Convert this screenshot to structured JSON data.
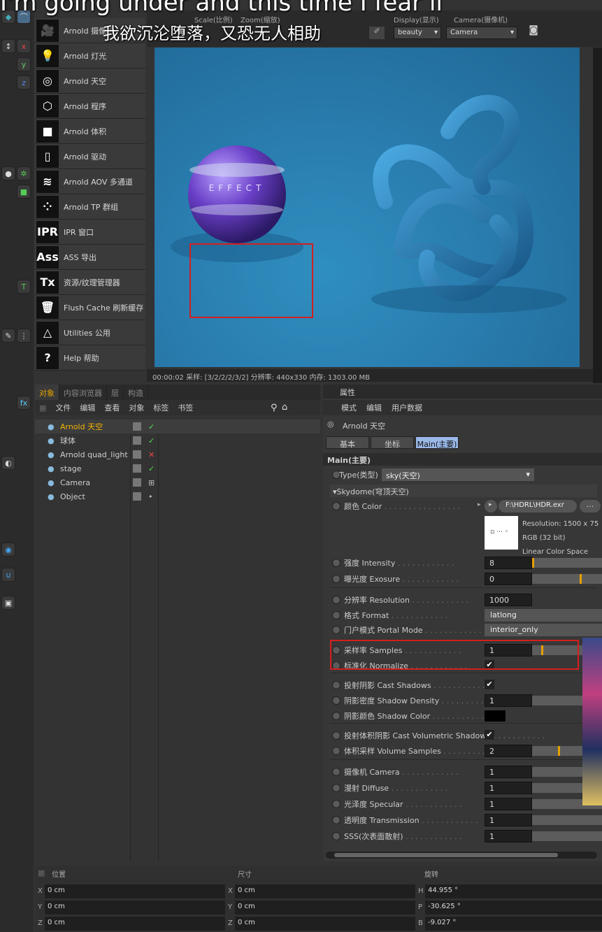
{
  "subtitles": {
    "english": "I'm going under and this time I fear li",
    "chinese": "我欲沉沦堕落，又恐无人相助"
  },
  "viewport_toolbar": {
    "scale_label": "Scale(比例)",
    "zoom_label": "Zoom(缩放)",
    "display_label": "Display(显示)",
    "display_value": "beauty",
    "camera_label": "Camera(摄像机)",
    "camera_value": "Camera"
  },
  "arnold_menu": [
    {
      "icon": "camera-icon",
      "label": "Arnold 摄像机"
    },
    {
      "icon": "lightbulb-icon",
      "label": "Arnold 灯光"
    },
    {
      "icon": "globe-icon",
      "label": "Arnold 天空"
    },
    {
      "icon": "cube-outline-icon",
      "label": "Arnold 程序"
    },
    {
      "icon": "cube-solid-icon",
      "label": "Arnold 体积"
    },
    {
      "icon": "document-icon",
      "label": "Arnold 驱动"
    },
    {
      "icon": "layers-icon",
      "label": "Arnold AOV 多通道"
    },
    {
      "icon": "dots-icon",
      "label": "Arnold TP 群组"
    },
    {
      "icon": "IPR",
      "label": "IPR 窗口"
    },
    {
      "icon": "Ass",
      "label": "ASS 导出"
    },
    {
      "icon": "Tx",
      "label": "资源/纹理管理器"
    },
    {
      "icon": "trash-icon",
      "label": "Flush Cache 刷新缓存"
    },
    {
      "icon": "utilities-icon",
      "label": "Utilities 公用"
    },
    {
      "icon": "?",
      "label": "Help 帮助"
    }
  ],
  "render": {
    "sphere_text": "EFFECT",
    "status": "00:00:02  采样: [3/2/2/2/3/2]  分辨率: 440x330  内存: 1303.00 MB"
  },
  "object_panel": {
    "tabs": [
      "对象",
      "内容浏览器",
      "层",
      "构造"
    ],
    "menu": [
      "文件",
      "编辑",
      "查看",
      "对象",
      "标签",
      "书签"
    ],
    "objects": [
      {
        "name": "Arnold 天空",
        "highlight": true,
        "status": "check"
      },
      {
        "name": "球体",
        "highlight": false,
        "status": "check"
      },
      {
        "name": "Arnold quad_light",
        "highlight": false,
        "status": "x"
      },
      {
        "name": "stage",
        "highlight": false,
        "status": "check"
      },
      {
        "name": "Camera",
        "highlight": false,
        "status": "grid"
      },
      {
        "name": "Object",
        "highlight": false,
        "status": "dot"
      }
    ]
  },
  "attr_panel": {
    "title": "属性",
    "menu": [
      "模式",
      "编辑",
      "用户数据"
    ],
    "object_name": "Arnold 天空",
    "tabs": [
      "基本",
      "坐标",
      "Main(主要)"
    ],
    "section": "Main(主要)",
    "type_label": "Type(类型)",
    "type_value": "sky(天空)",
    "subsection": "▾Skydome(穹顶天空)",
    "color_label": "颜色 Color",
    "file_path": "F:\\HDRL\\HDR.exr",
    "file_more": "...",
    "image_info": [
      "Resolution: 1500 x 75",
      "RGB (32 bit)",
      "Linear Color Space"
    ],
    "params": [
      {
        "label": "强度 Intensity",
        "value": "8",
        "slider": 0.0
      },
      {
        "label": "曝光度 Exosure",
        "value": "0",
        "slider": 0.68
      },
      {
        "label": "分辨率 Resolution",
        "value": "1000"
      },
      {
        "label": "格式 Format",
        "value": "latlong"
      },
      {
        "label": "门户模式 Portal Mode",
        "value": "interior_only"
      },
      {
        "label": "采样率 Samples",
        "value": "1",
        "slider": 0.13
      },
      {
        "label": "标准化 Normalize",
        "value": "✔"
      },
      {
        "label": "投射阴影 Cast Shadows",
        "value": "✔"
      },
      {
        "label": "阴影密度 Shadow Density",
        "value": "1"
      },
      {
        "label": "阴影颜色 Shadow Color",
        "value": ""
      },
      {
        "label": "投射体积阴影 Cast Volumetric Shadow",
        "value": "✔"
      },
      {
        "label": "体积采样 Volume Samples",
        "value": "2",
        "slider": 0.37
      },
      {
        "label": "摄像机 Camera",
        "value": "1"
      },
      {
        "label": "漫射 Diffuse",
        "value": "1"
      },
      {
        "label": "光泽度 Specular",
        "value": "1"
      },
      {
        "label": "透明度 Transmission",
        "value": "1"
      },
      {
        "label": "SSS(次表面散射)",
        "value": "1"
      }
    ]
  },
  "coords": {
    "headers": [
      "位置",
      "尺寸",
      "旋转"
    ],
    "position": [
      {
        "axis": "X",
        "value": "0 cm"
      },
      {
        "axis": "Y",
        "value": "0 cm"
      },
      {
        "axis": "Z",
        "value": "0 cm"
      }
    ],
    "size": [
      {
        "axis": "X",
        "value": "0 cm"
      },
      {
        "axis": "Y",
        "value": "0 cm"
      },
      {
        "axis": "Z",
        "value": "0 cm"
      }
    ],
    "rotation": [
      {
        "axis": "H",
        "value": "44.955 °"
      },
      {
        "axis": "P",
        "value": "-30.625 °"
      },
      {
        "axis": "B",
        "value": "-9.027 °"
      }
    ]
  }
}
